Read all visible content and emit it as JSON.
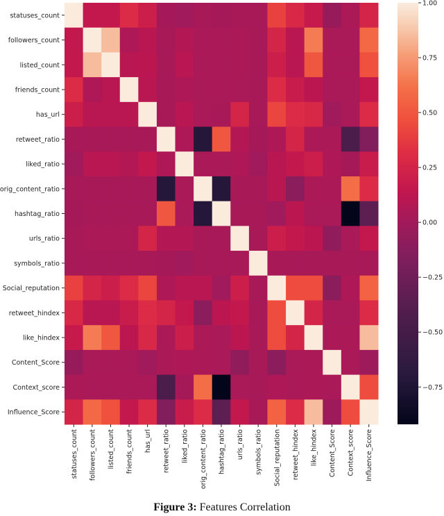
{
  "chart_data": {
    "type": "heatmap",
    "title": "",
    "xlabel": "",
    "ylabel": "",
    "labels": [
      "statuses_count",
      "followers_count",
      "listed_count",
      "friends_count",
      "has_url",
      "retweet_ratio",
      "liked_ratio",
      "orig_content_ratio",
      "hashtag_ratio",
      "urls_ratio",
      "symbols_ratio",
      "Social_reputation",
      "retweet_hindex",
      "like_hindex",
      "Content_Score",
      "Context_score",
      "Influence_Score"
    ],
    "colormap": "rocket",
    "vmin": -0.92,
    "vmax": 1.0,
    "colorbar_ticks": [
      1.0,
      0.75,
      0.5,
      0.25,
      0.0,
      -0.25,
      -0.5,
      -0.75
    ],
    "colorbar_tick_labels": [
      "1.00",
      "0.75",
      "0.50",
      "0.25",
      "0.00",
      "−0.25",
      "−0.50",
      "−0.75"
    ],
    "colorbar_position": "right",
    "matrix": [
      [
        1.0,
        0.15,
        0.15,
        0.3,
        0.2,
        0.02,
        0.0,
        0.03,
        0.02,
        0.03,
        0.03,
        0.4,
        0.28,
        0.17,
        -0.05,
        0.05,
        0.25
      ],
      [
        0.15,
        1.0,
        0.85,
        0.06,
        0.1,
        0.03,
        0.08,
        0.04,
        0.04,
        0.05,
        0.03,
        0.25,
        0.1,
        0.65,
        0.04,
        0.04,
        0.58
      ],
      [
        0.15,
        0.85,
        1.0,
        0.1,
        0.12,
        0.03,
        0.1,
        0.04,
        0.04,
        0.05,
        0.03,
        0.2,
        0.1,
        0.5,
        0.04,
        0.04,
        0.47
      ],
      [
        0.3,
        0.06,
        0.1,
        1.0,
        0.1,
        0.03,
        0.06,
        0.04,
        0.04,
        0.04,
        0.03,
        0.3,
        0.18,
        0.12,
        0.04,
        0.04,
        0.15
      ],
      [
        0.2,
        0.1,
        0.1,
        0.1,
        1.0,
        0.03,
        0.1,
        0.04,
        0.03,
        0.25,
        0.03,
        0.42,
        0.3,
        0.28,
        0.0,
        0.04,
        0.3
      ],
      [
        0.03,
        0.03,
        0.03,
        0.03,
        0.03,
        1.0,
        0.06,
        -0.72,
        0.5,
        0.08,
        0.02,
        0.06,
        0.25,
        0.05,
        0.05,
        -0.45,
        -0.15
      ],
      [
        0.0,
        0.1,
        0.1,
        0.08,
        0.15,
        0.06,
        1.0,
        0.04,
        0.04,
        0.06,
        0.0,
        0.1,
        0.15,
        0.2,
        0.06,
        0.02,
        0.18
      ],
      [
        0.03,
        0.03,
        0.03,
        0.03,
        0.03,
        -0.72,
        0.04,
        1.0,
        -0.72,
        0.03,
        0.03,
        0.1,
        -0.1,
        0.05,
        0.05,
        0.6,
        0.3
      ],
      [
        0.02,
        0.03,
        0.03,
        0.03,
        0.03,
        0.5,
        0.04,
        -0.72,
        1.0,
        0.03,
        0.03,
        0.0,
        0.12,
        0.04,
        0.04,
        -0.92,
        -0.35
      ],
      [
        0.03,
        0.05,
        0.05,
        0.05,
        0.25,
        0.08,
        0.08,
        0.03,
        0.03,
        1.0,
        0.03,
        0.2,
        0.15,
        0.12,
        -0.08,
        0.04,
        0.15
      ],
      [
        0.03,
        0.03,
        0.03,
        0.03,
        0.03,
        0.02,
        0.0,
        0.03,
        0.03,
        0.03,
        1.0,
        0.03,
        0.03,
        0.03,
        0.03,
        0.03,
        0.03
      ],
      [
        0.4,
        0.25,
        0.2,
        0.3,
        0.42,
        0.06,
        0.1,
        0.1,
        0.0,
        0.2,
        0.03,
        1.0,
        0.45,
        0.45,
        -0.1,
        0.06,
        0.55
      ],
      [
        0.28,
        0.1,
        0.1,
        0.18,
        0.3,
        0.25,
        0.15,
        -0.1,
        0.12,
        0.15,
        0.03,
        0.45,
        1.0,
        0.25,
        0.04,
        0.04,
        0.3
      ],
      [
        0.17,
        0.65,
        0.5,
        0.12,
        0.28,
        0.05,
        0.2,
        0.05,
        0.04,
        0.12,
        0.03,
        0.45,
        0.25,
        1.0,
        0.05,
        0.05,
        0.85
      ],
      [
        -0.05,
        0.04,
        0.04,
        0.04,
        0.0,
        0.05,
        0.06,
        0.05,
        0.04,
        -0.08,
        0.03,
        -0.1,
        0.04,
        0.05,
        1.0,
        0.04,
        -0.02
      ],
      [
        0.05,
        0.04,
        0.04,
        0.04,
        0.04,
        -0.45,
        0.02,
        0.6,
        -0.92,
        0.04,
        0.03,
        0.06,
        0.04,
        0.05,
        0.04,
        1.0,
        0.45
      ],
      [
        0.25,
        0.58,
        0.47,
        0.15,
        0.3,
        -0.15,
        0.18,
        0.3,
        -0.35,
        0.15,
        0.03,
        0.55,
        0.3,
        0.85,
        -0.02,
        0.45,
        1.0
      ]
    ]
  },
  "caption": {
    "label": "Figure 3:",
    "text": " Features Correlation"
  }
}
